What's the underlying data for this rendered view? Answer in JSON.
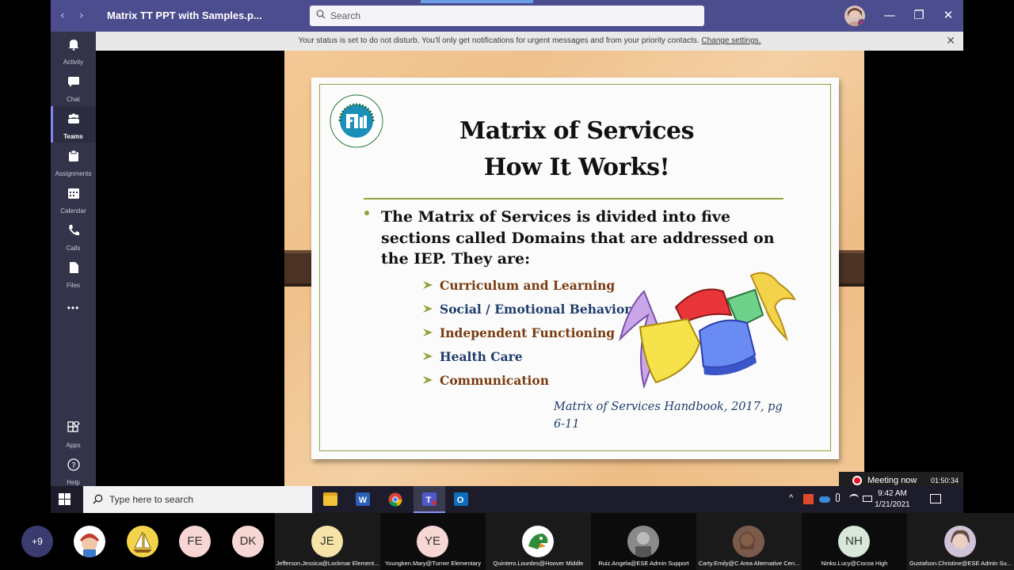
{
  "titlebar": {
    "title": "Matrix TT PPT with Samples.p...",
    "search_placeholder": "Search",
    "back_icon": "chevron-left-icon",
    "forward_icon": "chevron-right-icon",
    "minimize": "—",
    "restore": "❐",
    "close": "✕"
  },
  "rail": {
    "items": [
      {
        "label": "Activity",
        "icon": "bell-icon"
      },
      {
        "label": "Chat",
        "icon": "chat-icon"
      },
      {
        "label": "Teams",
        "icon": "teams-icon"
      },
      {
        "label": "Assignments",
        "icon": "assignments-icon"
      },
      {
        "label": "Calendar",
        "icon": "calendar-icon"
      },
      {
        "label": "Calls",
        "icon": "phone-icon"
      },
      {
        "label": "Files",
        "icon": "file-icon"
      },
      {
        "label": "Apps",
        "icon": "apps-icon"
      },
      {
        "label": "Help",
        "icon": "help-icon"
      }
    ],
    "more": "•••"
  },
  "banner": {
    "text": "Your status is set to do not disturb. You'll only get notifications for urgent messages and from your priority contacts. ",
    "link": "Change settings.",
    "close": "✕"
  },
  "slide": {
    "title_line1": "Matrix of  Services",
    "title_line2": "How It Works!",
    "bullet": "The Matrix of  Services is divided into five sections called Domains that are addressed on the IEP.  They are:",
    "domains": [
      {
        "label": "Curriculum and Learning",
        "color": "#7a3b10"
      },
      {
        "label": "Social / Emotional Behavior",
        "color": "#1f3d6b"
      },
      {
        "label": "Independent Functioning",
        "color": "#7a3b10"
      },
      {
        "label": "Health Care",
        "color": "#1f3d6b"
      },
      {
        "label": "Communication",
        "color": "#7a3b10"
      }
    ],
    "citation": "Matrix of  Services Handbook, 2017, pg 6-11",
    "accent": "#8ea43c"
  },
  "meeting": {
    "label": "Meeting now",
    "time": "01:50:34"
  },
  "taskbar": {
    "search_placeholder": "Type here to search",
    "time": "9:42 AM",
    "date": "1/21/2021",
    "apps": [
      "file-explorer-icon",
      "word-icon",
      "chrome-icon",
      "teams-icon",
      "outlook-icon"
    ]
  },
  "participants": {
    "overflow": "+9",
    "tiles": [
      {
        "initials": "FE",
        "bg": "#f7d7d3"
      },
      {
        "initials": "DK",
        "bg": "#f7d7d3"
      }
    ],
    "named": [
      {
        "initials": "JE",
        "name": "Jefferson.Jessica@Lockmar Element...",
        "bg": "#f5e3a8"
      },
      {
        "initials": "YE",
        "name": "Youngken.Mary@Turner Elementary",
        "bg": "#f7d7d3"
      },
      {
        "initials": "",
        "name": "Quintero.Lourdes@Hoover Middle",
        "bg": "#ffffff"
      },
      {
        "initials": "",
        "name": "Ruiz.Angela@ESE Admin Support",
        "bg": "#777777"
      },
      {
        "initials": "",
        "name": "Carty.Emily@C Area Alternative Cen...",
        "bg": "#8a6a5a"
      },
      {
        "initials": "NH",
        "name": "Ninko.Lucy@Cocoa High",
        "bg": "#d8e8d8"
      },
      {
        "initials": "",
        "name": "Gustafson.Christine@ESE Admin Su...",
        "bg": "#cfc3d8"
      }
    ]
  }
}
